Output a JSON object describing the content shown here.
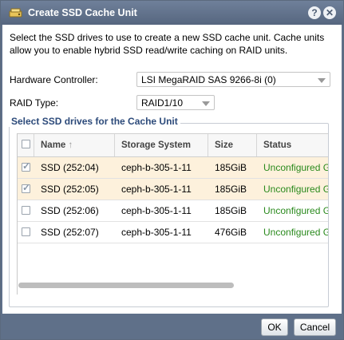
{
  "dialog": {
    "title": "Create SSD Cache Unit",
    "help_icon": "help-icon",
    "close_icon": "close-icon",
    "intro": "Select the SSD drives to use to create a new SSD cache unit. Cache units allow you to enable hybrid SSD read/write caching on RAID units."
  },
  "form": {
    "controller_label": "Hardware Controller:",
    "controller_value": "LSI MegaRAID SAS 9266-8i (0)",
    "raid_label": "RAID Type:",
    "raid_value": "RAID1/10"
  },
  "grid": {
    "legend": "Select SSD drives for the Cache Unit",
    "columns": [
      "Name",
      "Storage System",
      "Size",
      "Status"
    ],
    "rows": [
      {
        "checked": true,
        "name": "SSD (252:04)",
        "system": "ceph-b-305-1-11",
        "size": "185GiB",
        "status": "Unconfigured G"
      },
      {
        "checked": true,
        "name": "SSD (252:05)",
        "system": "ceph-b-305-1-11",
        "size": "185GiB",
        "status": "Unconfigured G"
      },
      {
        "checked": false,
        "name": "SSD (252:06)",
        "system": "ceph-b-305-1-11",
        "size": "185GiB",
        "status": "Unconfigured G"
      },
      {
        "checked": false,
        "name": "SSD (252:07)",
        "system": "ceph-b-305-1-11",
        "size": "476GiB",
        "status": "Unconfigured G"
      }
    ]
  },
  "footer": {
    "ok": "OK",
    "cancel": "Cancel"
  },
  "colors": {
    "titlebar": "#5f7089",
    "selected_row": "#fdf1dc",
    "status_text": "#2a8a1d",
    "legend_text": "#2c4a7a"
  }
}
